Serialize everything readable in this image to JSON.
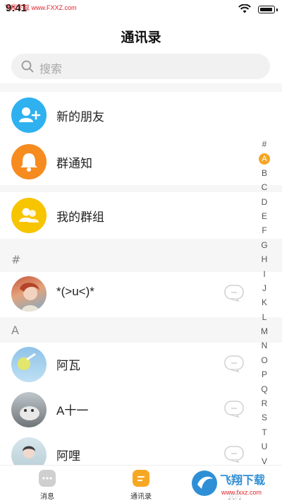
{
  "status_bar": {
    "time": "9:41",
    "watermark": "飞翔下载 www.FXXZ.com"
  },
  "header": {
    "title": "通讯录",
    "search_placeholder": "搜索"
  },
  "special_rows": [
    {
      "label": "新的朋友",
      "icon": "add-user-icon",
      "color": "#2fb1f0"
    },
    {
      "label": "群通知",
      "icon": "bell-icon",
      "color": "#f68b1f"
    },
    {
      "label": "我的群组",
      "icon": "group-icon",
      "color": "#f7c400"
    }
  ],
  "groups": [
    {
      "header": "#",
      "contacts": [
        {
          "name": "*(>u<)*"
        }
      ]
    },
    {
      "header": "A",
      "contacts": [
        {
          "name": "阿瓦"
        },
        {
          "name": "A十一"
        },
        {
          "name": "阿哩"
        }
      ]
    }
  ],
  "index_letters": [
    "#",
    "A",
    "B",
    "C",
    "D",
    "E",
    "F",
    "G",
    "H",
    "I",
    "J",
    "K",
    "L",
    "M",
    "N",
    "O",
    "P",
    "Q",
    "R",
    "S",
    "T",
    "U",
    "V"
  ],
  "index_active": "A",
  "tabs": [
    {
      "label": "消息",
      "icon": "message-icon",
      "color": "#cfcfcf"
    },
    {
      "label": "通讯录",
      "icon": "contacts-icon",
      "color": "#f7a823",
      "active": true
    },
    {
      "label": "我的",
      "icon": "profile-icon",
      "color": "#cfcfcf"
    }
  ],
  "watermark_logo": {
    "brand": "飞翔下载",
    "url": "www.fxxz.com"
  },
  "colors": {
    "accent": "#f5a623"
  }
}
